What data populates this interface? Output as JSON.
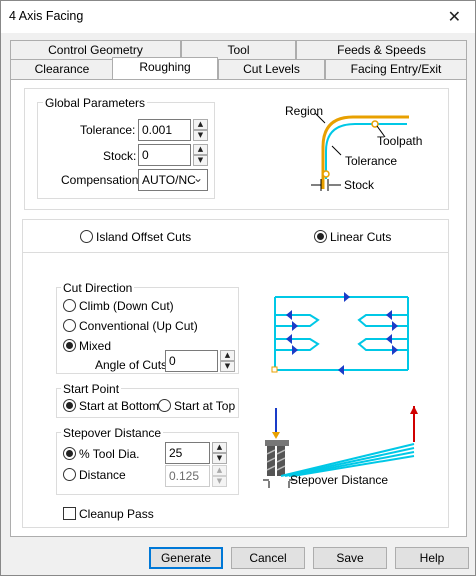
{
  "window": {
    "title": "4 Axis Facing",
    "close_icon": "close-icon"
  },
  "tabs_row1": [
    {
      "label": "Control Geometry"
    },
    {
      "label": "Tool"
    },
    {
      "label": "Feeds & Speeds"
    }
  ],
  "tabs_row2": [
    {
      "label": "Clearance"
    },
    {
      "label": "Roughing",
      "active": true
    },
    {
      "label": "Cut Levels"
    },
    {
      "label": "Facing Entry/Exit"
    }
  ],
  "global": {
    "title": "Global Parameters",
    "tolerance_label": "Tolerance:",
    "tolerance_value": "0.001",
    "stock_label": "Stock:",
    "stock_value": "0",
    "compensation_label": "Compensation:",
    "compensation_value": "AUTO/NC"
  },
  "diagram1": {
    "region": "Region",
    "toolpath": "Toolpath",
    "tolerance": "Tolerance",
    "stock": "Stock"
  },
  "mode": {
    "island": "Island Offset Cuts",
    "linear": "Linear Cuts",
    "selected": "linear"
  },
  "cut_direction": {
    "title": "Cut Direction",
    "climb": "Climb (Down Cut)",
    "conventional": "Conventional (Up Cut)",
    "mixed": "Mixed",
    "selected": "mixed",
    "angle_label": "Angle of Cuts",
    "angle_value": "0"
  },
  "start_point": {
    "title": "Start Point",
    "bottom": "Start at Bottom",
    "top": "Start at Top",
    "selected": "bottom"
  },
  "stepover": {
    "title": "Stepover Distance",
    "percent_label": "% Tool Dia.",
    "percent_value": "25",
    "distance_label": "Distance",
    "distance_value": "0.125",
    "selected": "percent",
    "diagram_label": "Stepover Distance"
  },
  "cleanup": {
    "label": "Cleanup Pass",
    "checked": false
  },
  "buttons": {
    "generate": "Generate",
    "cancel": "Cancel",
    "save": "Save",
    "help": "Help"
  },
  "colors": {
    "accent": "#0078d7",
    "cyan": "#00c8e6",
    "orange": "#e8a000",
    "blue": "#1a3cc8",
    "red": "#d00000"
  }
}
